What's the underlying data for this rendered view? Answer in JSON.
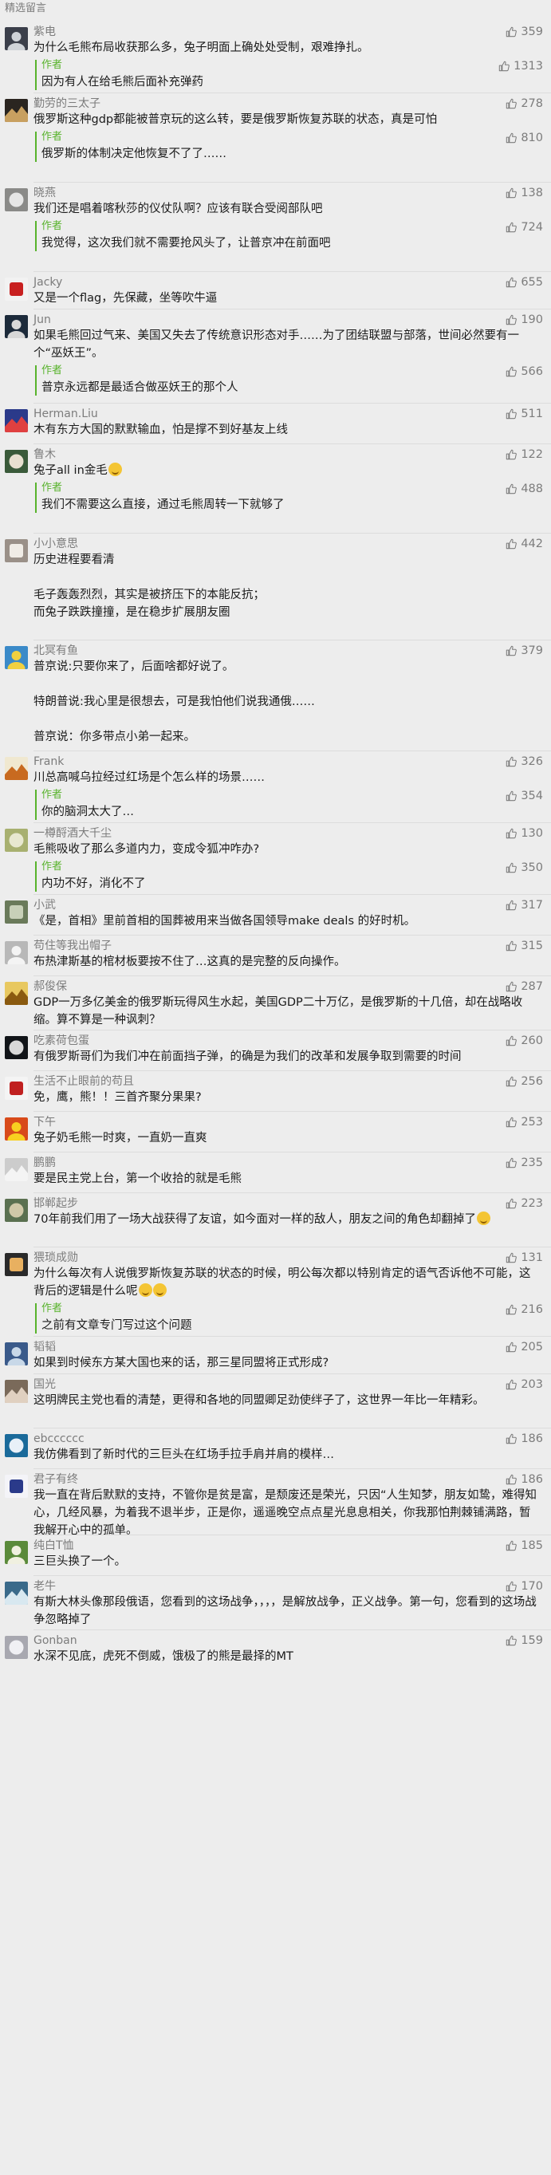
{
  "section_title": "精选留言",
  "colors": {
    "accent_green": "#58b32c",
    "meta_gray": "#7c7c7c",
    "background": "#ededed",
    "divider": "#dcdcdc"
  },
  "icons": {
    "like": "thumbs-up-icon",
    "author_reply_bar": "green-vertical-bar"
  },
  "author_label": "作者",
  "comments": [
    {
      "nick": "紫电",
      "likes": "359",
      "avatar_color": "#3b3f4a",
      "avatar_fg": "#cfd3d8",
      "text": "为什么毛熊布局收获那么多，兔子明面上确处处受制，艰难挣扎。",
      "reply": {
        "text": "因为有人在给毛熊后面补充弹药",
        "likes": "1313"
      }
    },
    {
      "nick": "勤劳的三太子",
      "likes": "278",
      "avatar_color": "#2a2520",
      "avatar_fg": "#c8a060",
      "text": "俄罗斯这种gdp都能被普京玩的这么转，要是俄罗斯恢复苏联的状态，真是可怕",
      "reply": {
        "text": "俄罗斯的体制决定他恢复不了了……",
        "likes": "810"
      }
    },
    {
      "nick": "晓燕",
      "likes": "138",
      "avatar_color": "#8a8a88",
      "avatar_fg": "#e6e6e6",
      "text": "我们还是唱着喀秋莎的仪仗队啊？应该有联合受阅部队吧",
      "reply": {
        "text": "我觉得，这次我们就不需要抢风头了，让普京冲在前面吧",
        "likes": "724"
      }
    },
    {
      "nick": "Jacky",
      "likes": "655",
      "avatar_color": "#f2f2f2",
      "avatar_fg": "#c82020",
      "text": "又是一个flag，先保藏，坐等吹牛逼"
    },
    {
      "nick": "Jun",
      "likes": "190",
      "avatar_color": "#1c2a3a",
      "avatar_fg": "#d8d8d8",
      "text": "如果毛熊回过气来、美国又失去了传统意识形态对手……为了团结联盟与部落，世间必然要有一个“巫妖王”。",
      "reply": {
        "text": "普京永远都是最适合做巫妖王的那个人",
        "likes": "566"
      }
    },
    {
      "nick": "Herman.Liu",
      "likes": "511",
      "avatar_color": "#2b3a8a",
      "avatar_fg": "#e04040",
      "text": "木有东方大国的默默输血，怕是撑不到好基友上线"
    },
    {
      "nick": "鲁木",
      "likes": "122",
      "avatar_color": "#3a5a3a",
      "avatar_fg": "#e8e0d0",
      "text": "兔子all in金毛",
      "emoji_count": 1,
      "reply": {
        "text": "我们不需要这么直接，通过毛熊周转一下就够了",
        "likes": "488"
      }
    },
    {
      "nick": "小小意思",
      "likes": "442",
      "avatar_color": "#9a9088",
      "avatar_fg": "#f0ece6",
      "text": "历史进程要看清\n\n毛子轰轰烈烈，其实是被挤压下的本能反抗；\n而兔子跌跌撞撞，是在稳步扩展朋友圈"
    },
    {
      "nick": "北冥有鱼",
      "likes": "379",
      "avatar_color": "#3a8ac8",
      "avatar_fg": "#f0d040",
      "text": "普京说:只要你来了，后面啥都好说了。\n\n特朗普说:我心里是很想去，可是我怕他们说我通俄……\n\n普京说：你多带点小弟一起来。"
    },
    {
      "nick": "Frank",
      "likes": "326",
      "avatar_color": "#f0e8d0",
      "avatar_fg": "#c86a20",
      "text": "川总高喊乌拉经过红场是个怎么样的场景……",
      "reply": {
        "text": "你的脑洞太大了…",
        "likes": "354"
      }
    },
    {
      "nick": "一樽酹酒大千尘",
      "likes": "130",
      "avatar_color": "#a8b070",
      "avatar_fg": "#e8e8d0",
      "text": "毛熊吸收了那么多道内力，变成令狐冲咋办?",
      "reply": {
        "text": "内功不好，消化不了",
        "likes": "350"
      }
    },
    {
      "nick": "小武",
      "likes": "317",
      "avatar_color": "#6a7a5a",
      "avatar_fg": "#c8d0b8",
      "text": "《是，首相》里前首相的国葬被用来当做各国领导make deals 的好时机。"
    },
    {
      "nick": "苟住等我出帽子",
      "likes": "315",
      "avatar_color": "#b8b8b8",
      "avatar_fg": "#f4f4f4",
      "text": "布热津斯基的棺材板要按不住了…这真的是完整的反向操作。"
    },
    {
      "nick": "郝俊保",
      "likes": "287",
      "avatar_color": "#e8c860",
      "avatar_fg": "#8a5a10",
      "text": "GDP一万多亿美金的俄罗斯玩得风生水起，美国GDP二十万亿，是俄罗斯的十几倍，却在战略收缩。算不算是一种讽刺？"
    },
    {
      "nick": "吃素荷包蛋",
      "likes": "260",
      "avatar_color": "#111418",
      "avatar_fg": "#d8d8d8",
      "text": "有俄罗斯哥们为我们冲在前面挡子弹，的确是为我们的改革和发展争取到需要的时间"
    },
    {
      "nick": "生活不止眼前的苟且",
      "likes": "256",
      "avatar_color": "#f4f4f4",
      "avatar_fg": "#c02020",
      "text": "免，鹰，熊！！三首齐聚分果果?"
    },
    {
      "nick": "下午",
      "likes": "253",
      "avatar_color": "#d84a1a",
      "avatar_fg": "#f8d020",
      "text": "兔子奶毛熊一时爽，一直奶一直爽"
    },
    {
      "nick": "鹏鹏",
      "likes": "235",
      "avatar_color": "#cccccc",
      "avatar_fg": "#f4f4f4",
      "text": "要是民主党上台，第一个收拾的就是毛熊"
    },
    {
      "nick": "邯郸起步",
      "likes": "223",
      "avatar_color": "#5a7050",
      "avatar_fg": "#d0c8a8",
      "text": "70年前我们用了一场大战获得了友谊，如今面对一样的敌人，朋友之间的角色却翻掉了",
      "emoji_count": 1
    },
    {
      "nick": "猥琐成勋",
      "likes": "131",
      "avatar_color": "#2a2a2a",
      "avatar_fg": "#e8b060",
      "text": "为什么每次有人说俄罗斯恢复苏联的状态的时候，明公每次都以特别肯定的语气否诉他不可能，这背后的逻辑是什么呢",
      "emoji_count": 2,
      "reply": {
        "text": "之前有文章专门写过这个问题",
        "likes": "216"
      }
    },
    {
      "nick": "韬韬",
      "likes": "205",
      "avatar_color": "#3a5a8a",
      "avatar_fg": "#c8d8e8",
      "text": "如果到时候东方某大国也来的话，那三星同盟将正式形成?"
    },
    {
      "nick": "国光",
      "likes": "203",
      "avatar_color": "#7a6a5a",
      "avatar_fg": "#e0d0c0",
      "text": "这明牌民主党也看的清楚，更得和各地的同盟卿足劲使绊子了，这世界一年比一年精彩。"
    },
    {
      "nick": "ebcccccc",
      "likes": "186",
      "avatar_color": "#1a6a9a",
      "avatar_fg": "#e8f0f8",
      "text": "我仿佛看到了新时代的三巨头在红场手拉手肩并肩的模样…"
    },
    {
      "nick": "君子有终",
      "likes": "186",
      "avatar_color": "#f4f4f8",
      "avatar_fg": "#2a3a8a",
      "text": "我一直在背后默默的支持，不管你是贫是富，是颓废还是荣光，只因“人生知梦，朋友如鸷，难得知心，几经风暴，为着我不退半步，正是你，遥遥晚空点点星光息息相关，你我那怕荆棘铺满路，暂我解开心中的孤单。"
    },
    {
      "nick": "纯白T恤",
      "likes": "185",
      "avatar_color": "#5a8a3a",
      "avatar_fg": "#f0f0e0",
      "text": "三巨头换了一个。"
    },
    {
      "nick": "老牛",
      "likes": "170",
      "avatar_color": "#3a6a8a",
      "avatar_fg": "#d8e8f0",
      "text": "有斯大林头像那段俄语，您看到的这场战争，，，，是解放战争，正义战争。第一句，您看到的这场战争忽略掉了"
    },
    {
      "nick": "Gonban",
      "likes": "159",
      "avatar_color": "#a8a8b0",
      "avatar_fg": "#f0f0f4",
      "text": "水深不见底，虎死不倒威，饿极了的熊是最择的MT"
    }
  ]
}
